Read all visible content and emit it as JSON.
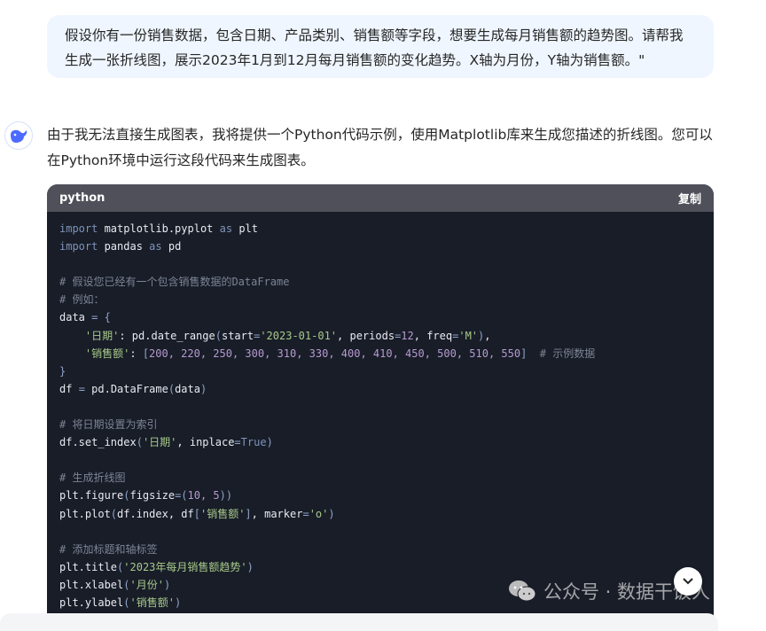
{
  "user_message": "假设你有一份销售数据，包含日期、产品类别、销售额等字段，想要生成每月销售额的趋势图。请帮我生成一张折线图，展示2023年1月到12月每月销售额的变化趋势。X轴为月份，Y轴为销售额。\"",
  "assistant": {
    "avatar_icon": "deepseek-whale-icon",
    "reply_text": "由于我无法直接生成图表，我将提供一个Python代码示例，使用Matplotlib库来生成您描述的折线图。您可以在Python环境中运行这段代码来生成图表。",
    "code_block": {
      "language": "python",
      "copy_label": "复制",
      "lines": [
        [
          [
            "kw",
            "import "
          ],
          [
            "",
            "matplotlib.pyplot "
          ],
          [
            "kw",
            "as "
          ],
          [
            "",
            "plt"
          ]
        ],
        [
          [
            "kw",
            "import "
          ],
          [
            "",
            "pandas "
          ],
          [
            "kw",
            "as "
          ],
          [
            "",
            "pd"
          ]
        ],
        [],
        [
          [
            "com",
            "# 假设您已经有一个包含销售数据的DataFrame"
          ]
        ],
        [
          [
            "com",
            "# 例如："
          ]
        ],
        [
          [
            "",
            "data "
          ],
          [
            "op",
            "= {"
          ]
        ],
        [
          [
            "",
            "    "
          ],
          [
            "str",
            "'日期'"
          ],
          [
            "",
            ": pd.date_range"
          ],
          [
            "op",
            "("
          ],
          [
            "",
            "start"
          ],
          [
            "op",
            "="
          ],
          [
            "str",
            "'2023-01-01'"
          ],
          [
            "",
            ", periods"
          ],
          [
            "op",
            "="
          ],
          [
            "num",
            "12"
          ],
          [
            "",
            ", freq"
          ],
          [
            "op",
            "="
          ],
          [
            "str",
            "'M'"
          ],
          [
            "op",
            ")"
          ],
          [
            "",
            ","
          ]
        ],
        [
          [
            "",
            "    "
          ],
          [
            "str",
            "'销售额'"
          ],
          [
            "",
            ": "
          ],
          [
            "op",
            "["
          ],
          [
            "num",
            "200, 220, 250, 300, 310, 330, 400, 410, 450, 500, 510, 550"
          ],
          [
            "op",
            "]"
          ],
          [
            "",
            "  "
          ],
          [
            "com",
            "# 示例数据"
          ]
        ],
        [
          [
            "op",
            "}"
          ]
        ],
        [
          [
            "",
            "df "
          ],
          [
            "op",
            "="
          ],
          [
            "",
            " pd.DataFrame"
          ],
          [
            "op",
            "("
          ],
          [
            "",
            "data"
          ],
          [
            "op",
            ")"
          ]
        ],
        [],
        [
          [
            "com",
            "# 将日期设置为索引"
          ]
        ],
        [
          [
            "",
            "df.set_index"
          ],
          [
            "op",
            "("
          ],
          [
            "str",
            "'日期'"
          ],
          [
            "",
            ", inplace"
          ],
          [
            "op",
            "="
          ],
          [
            "kw",
            "True"
          ],
          [
            "op",
            ")"
          ]
        ],
        [],
        [
          [
            "com",
            "# 生成折线图"
          ]
        ],
        [
          [
            "",
            "plt.figure"
          ],
          [
            "op",
            "("
          ],
          [
            "",
            "figsize"
          ],
          [
            "op",
            "=("
          ],
          [
            "num",
            "10, 5"
          ],
          [
            "op",
            "))"
          ]
        ],
        [
          [
            "",
            "plt.plot"
          ],
          [
            "op",
            "("
          ],
          [
            "",
            "df.index, df"
          ],
          [
            "op",
            "["
          ],
          [
            "str",
            "'销售额'"
          ],
          [
            "op",
            "]"
          ],
          [
            "",
            ", marker"
          ],
          [
            "op",
            "="
          ],
          [
            "str",
            "'o'"
          ],
          [
            "op",
            ")"
          ]
        ],
        [],
        [
          [
            "com",
            "# 添加标题和轴标签"
          ]
        ],
        [
          [
            "",
            "plt.title"
          ],
          [
            "op",
            "("
          ],
          [
            "str",
            "'2023年每月销售额趋势'"
          ],
          [
            "op",
            ")"
          ]
        ],
        [
          [
            "",
            "plt.xlabel"
          ],
          [
            "op",
            "("
          ],
          [
            "str",
            "'月份'"
          ],
          [
            "op",
            ")"
          ]
        ],
        [
          [
            "",
            "plt.ylabel"
          ],
          [
            "op",
            "("
          ],
          [
            "str",
            "'销售额'"
          ],
          [
            "op",
            ")"
          ]
        ]
      ]
    }
  },
  "scroll_button_icon": "chevron-down-icon",
  "watermark": "公众号 · 数据干饭人"
}
